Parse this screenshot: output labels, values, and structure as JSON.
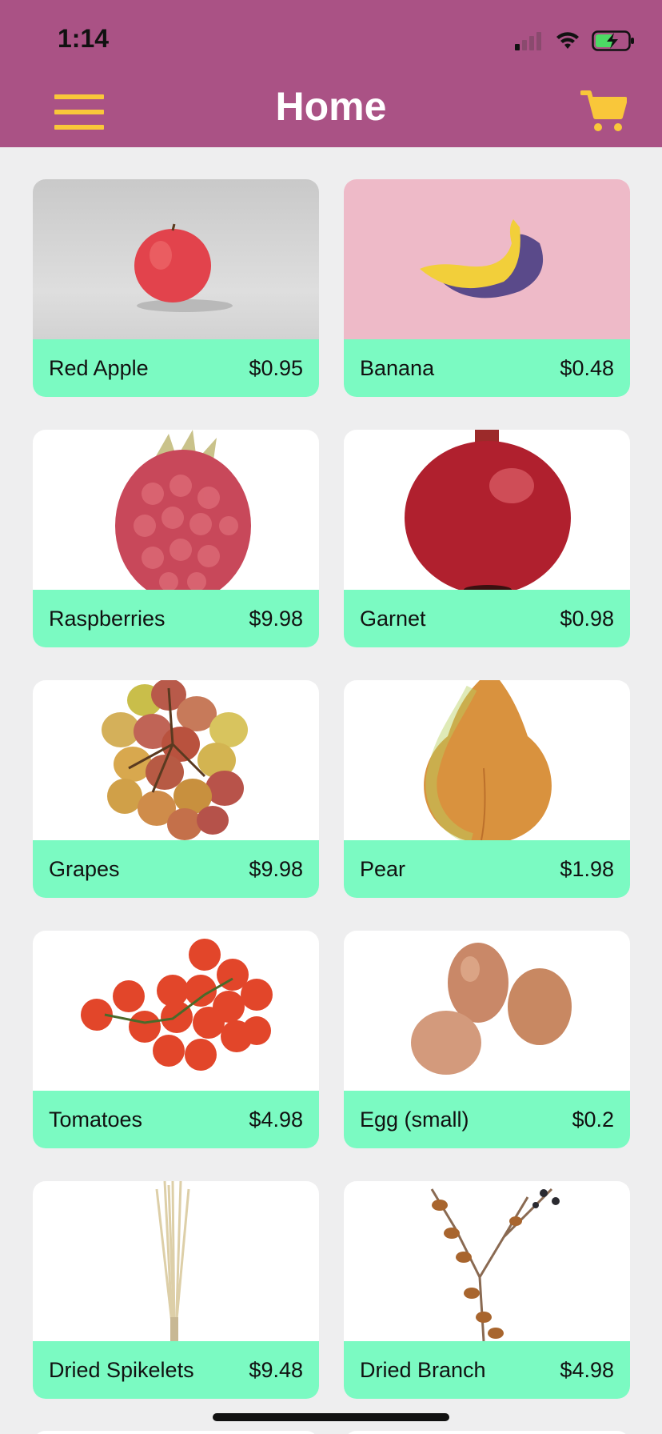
{
  "status": {
    "time": "1:14"
  },
  "header": {
    "title": "Home"
  },
  "products": [
    {
      "name": "Red Apple",
      "price": "$0.95"
    },
    {
      "name": "Banana",
      "price": "$0.48"
    },
    {
      "name": "Raspberries",
      "price": "$9.98"
    },
    {
      "name": "Garnet",
      "price": "$0.98"
    },
    {
      "name": "Grapes",
      "price": "$9.98"
    },
    {
      "name": "Pear",
      "price": "$1.98"
    },
    {
      "name": "Tomatoes",
      "price": "$4.98"
    },
    {
      "name": "Egg (small)",
      "price": "$0.2"
    },
    {
      "name": "Dried Spikelets",
      "price": "$9.48"
    },
    {
      "name": "Dried Branch",
      "price": "$4.98"
    }
  ],
  "colors": {
    "appbar": "#AA5285",
    "accent": "#F9C73A",
    "price_bar": "#7BFAC2",
    "background": "#EEEEEF"
  },
  "icons": [
    "menu-icon",
    "cart-icon",
    "signal-icon",
    "wifi-icon",
    "battery-icon"
  ]
}
